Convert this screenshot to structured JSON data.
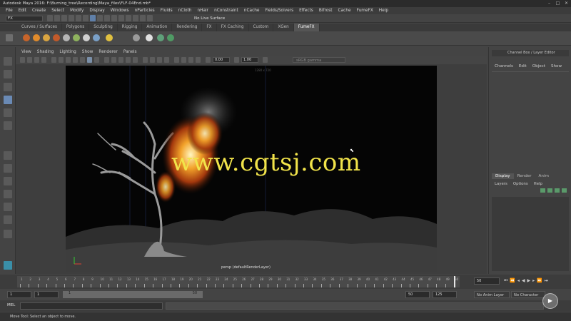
{
  "window": {
    "title": "Autodesk Maya 2016: F:\\Burning_tree\\Recording\\Maya_files\\FLF-04End.mb*"
  },
  "menubar": {
    "items": [
      "File",
      "Edit",
      "Create",
      "Select",
      "Modify",
      "Display",
      "Windows",
      "nParticles",
      "Fluids",
      "nCloth",
      "nHair",
      "nConstraint",
      "nCache",
      "Fields/Solvers",
      "Effects",
      "Bifrost",
      "Cache",
      "FumeFX",
      "Help"
    ]
  },
  "status": {
    "mode": "FX",
    "live_surface": "No Live Surface"
  },
  "shelf_tabs": [
    "Curves / Surfaces",
    "Polygons",
    "Sculpting",
    "Rigging",
    "Animation",
    "Rendering",
    "FX",
    "FX Caching",
    "Custom",
    "XGen",
    "FumeFX"
  ],
  "shelf_active": "FumeFX",
  "panel_menu": [
    "View",
    "Shading",
    "Lighting",
    "Show",
    "Renderer",
    "Panels"
  ],
  "panel_toolbar": {
    "exposure": "0.00",
    "gamma": "1.00",
    "color_space": "sRGB gamma"
  },
  "viewport": {
    "resolution_gate": "1280 x 720",
    "camera_label": "persp (defaultRenderLayer)",
    "watermark": "www.cgtsj.com"
  },
  "channel_box": {
    "title": "Channel Box / Layer Editor",
    "menu": [
      "Channels",
      "Edit",
      "Object",
      "Show"
    ]
  },
  "layer_editor": {
    "tabs": [
      "Display",
      "Render",
      "Anim"
    ],
    "active_tab": "Display",
    "menu": [
      "Layers",
      "Options",
      "Help"
    ]
  },
  "time_slider": {
    "tick_labels": [
      "1",
      "2",
      "3",
      "4",
      "5",
      "6",
      "7",
      "8",
      "9",
      "10",
      "11",
      "12",
      "13",
      "14",
      "15",
      "16",
      "17",
      "18",
      "19",
      "20",
      "21",
      "22",
      "23",
      "24",
      "25",
      "26",
      "27",
      "28",
      "29",
      "30",
      "31",
      "32",
      "33",
      "34",
      "35",
      "36",
      "37",
      "38",
      "39",
      "40",
      "41",
      "42",
      "43",
      "44",
      "45",
      "46",
      "47",
      "48",
      "49",
      "50"
    ],
    "current_frame": "50",
    "right_label": "50"
  },
  "range_slider": {
    "start": "1",
    "start_inner": "1",
    "range_start_label": "1",
    "range_end_label": "50",
    "end_inner": "50",
    "end": "125",
    "anim_layer": "No Anim Layer",
    "character_set": "No Character Set"
  },
  "command_line": {
    "mel_label": "MEL"
  },
  "help_line": {
    "text": "Move Tool: Select an object to move."
  },
  "colors": {
    "viewport_bg": "#050505",
    "watermark": "#f1e34a",
    "accent": "#5f7fa8"
  }
}
